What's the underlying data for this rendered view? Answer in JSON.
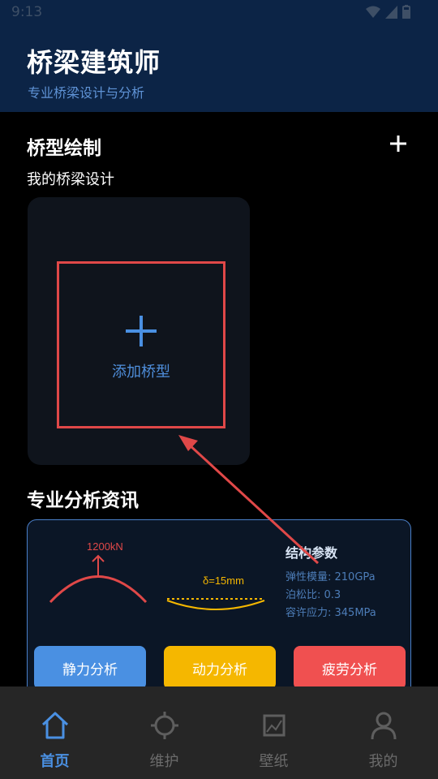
{
  "status_bar": {
    "time": "9:13"
  },
  "header": {
    "title": "桥梁建筑师",
    "subtitle": "专业桥梁设计与分析"
  },
  "bridge_drawing": {
    "title": "桥型绘制",
    "my_designs_label": "我的桥梁设计",
    "add_label": "添加桥型"
  },
  "analysis": {
    "title": "专业分析资讯",
    "load_label": "1200kN",
    "deflection_label": "δ=15mm",
    "params_title": "结构参数",
    "params": [
      "弹性模量: 210GPa",
      "泊松比: 0.3",
      "容许应力: 345MPa"
    ],
    "buttons": {
      "static": "静力分析",
      "dynamic": "动力分析",
      "fatigue": "疲劳分析"
    },
    "colors": {
      "static": "#4a90e2",
      "dynamic": "#f5b700",
      "fatigue": "#f05050"
    }
  },
  "nav": {
    "items": [
      {
        "label": "首页",
        "icon": "home-icon",
        "active": true
      },
      {
        "label": "维护",
        "icon": "crosshair-icon",
        "active": false
      },
      {
        "label": "壁纸",
        "icon": "image-chart-icon",
        "active": false
      },
      {
        "label": "我的",
        "icon": "person-icon",
        "active": false
      }
    ]
  },
  "colors": {
    "accent": "#4a90e2",
    "header_bg": "#0c2446",
    "highlight": "#e04848"
  }
}
